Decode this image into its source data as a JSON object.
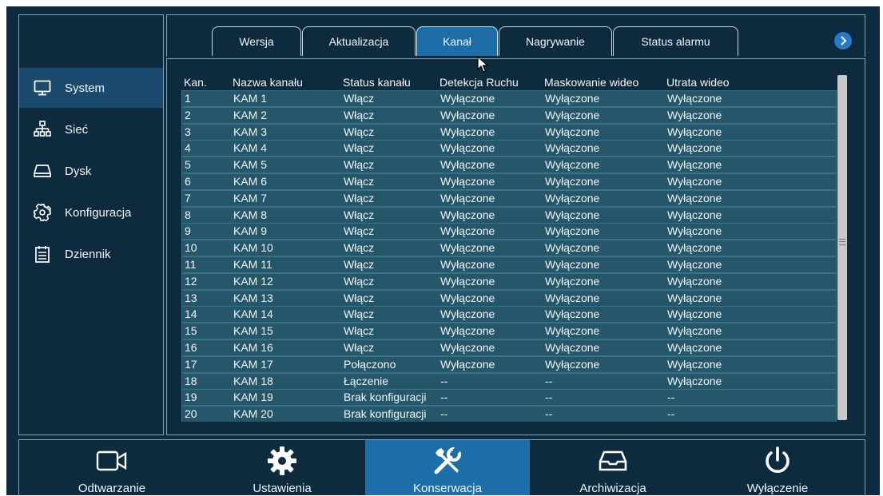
{
  "sidebar": {
    "items": [
      {
        "label": "System",
        "icon": "monitor-icon"
      },
      {
        "label": "Sieć",
        "icon": "network-icon"
      },
      {
        "label": "Dysk",
        "icon": "disk-icon"
      },
      {
        "label": "Konfiguracja",
        "icon": "gear-icon"
      },
      {
        "label": "Dziennik",
        "icon": "log-icon"
      }
    ]
  },
  "tabs": [
    {
      "label": "Wersja"
    },
    {
      "label": "Aktualizacja"
    },
    {
      "label": "Kanał"
    },
    {
      "label": "Nagrywanie"
    },
    {
      "label": "Status alarmu"
    }
  ],
  "table": {
    "headers": [
      "Kan.",
      "Nazwa kanału",
      "Status kanału",
      "Detekcja Ruchu",
      "Maskowanie wideo",
      "Utrata wideo"
    ],
    "rows": [
      [
        "1",
        "KAM 1",
        "Włącz",
        "Wyłączone",
        "Wyłączone",
        "Wyłączone"
      ],
      [
        "2",
        "KAM 2",
        "Włącz",
        "Wyłączone",
        "Wyłączone",
        "Wyłączone"
      ],
      [
        "3",
        "KAM 3",
        "Włącz",
        "Wyłączone",
        "Wyłączone",
        "Wyłączone"
      ],
      [
        "4",
        "KAM 4",
        "Włącz",
        "Wyłączone",
        "Wyłączone",
        "Wyłączone"
      ],
      [
        "5",
        "KAM 5",
        "Włącz",
        "Wyłączone",
        "Wyłączone",
        "Wyłączone"
      ],
      [
        "6",
        "KAM 6",
        "Włącz",
        "Wyłączone",
        "Wyłączone",
        "Wyłączone"
      ],
      [
        "7",
        "KAM 7",
        "Włącz",
        "Wyłączone",
        "Wyłączone",
        "Wyłączone"
      ],
      [
        "8",
        "KAM 8",
        "Włącz",
        "Wyłączone",
        "Wyłączone",
        "Wyłączone"
      ],
      [
        "9",
        "KAM 9",
        "Włącz",
        "Wyłączone",
        "Wyłączone",
        "Wyłączone"
      ],
      [
        "10",
        "KAM 10",
        "Włącz",
        "Wyłączone",
        "Wyłączone",
        "Wyłączone"
      ],
      [
        "11",
        "KAM 11",
        "Włącz",
        "Wyłączone",
        "Wyłączone",
        "Wyłączone"
      ],
      [
        "12",
        "KAM 12",
        "Włącz",
        "Wyłączone",
        "Wyłączone",
        "Wyłączone"
      ],
      [
        "13",
        "KAM 13",
        "Włącz",
        "Wyłączone",
        "Wyłączone",
        "Wyłączone"
      ],
      [
        "14",
        "KAM 14",
        "Włącz",
        "Wyłączone",
        "Wyłączone",
        "Wyłączone"
      ],
      [
        "15",
        "KAM 15",
        "Włącz",
        "Wyłączone",
        "Wyłączone",
        "Wyłączone"
      ],
      [
        "16",
        "KAM 16",
        "Włącz",
        "Wyłączone",
        "Wyłączone",
        "Wyłączone"
      ],
      [
        "17",
        "KAM 17",
        "Połączono",
        "Wyłączone",
        "Wyłączone",
        "Wyłączone"
      ],
      [
        "18",
        "KAM 18",
        "Łączenie",
        "--",
        "--",
        "Wyłączone"
      ],
      [
        "19",
        "KAM 19",
        "Brak konfiguracji",
        "--",
        "--",
        "--"
      ],
      [
        "20",
        "KAM 20",
        "Brak konfiguracji",
        "--",
        "--",
        "--"
      ]
    ]
  },
  "bottom_nav": [
    {
      "label": "Odtwarzanie",
      "icon": "camera-icon"
    },
    {
      "label": "Ustawienia",
      "icon": "gear-icon"
    },
    {
      "label": "Konserwacja",
      "icon": "tools-icon"
    },
    {
      "label": "Archiwizacja",
      "icon": "archive-drive-icon"
    },
    {
      "label": "Wyłączenie",
      "icon": "power-icon"
    }
  ],
  "colors": {
    "background": "#0e2a3f",
    "active": "#1d6ea8",
    "row": "#25566a",
    "sidebar_active": "#1a4a6d"
  }
}
